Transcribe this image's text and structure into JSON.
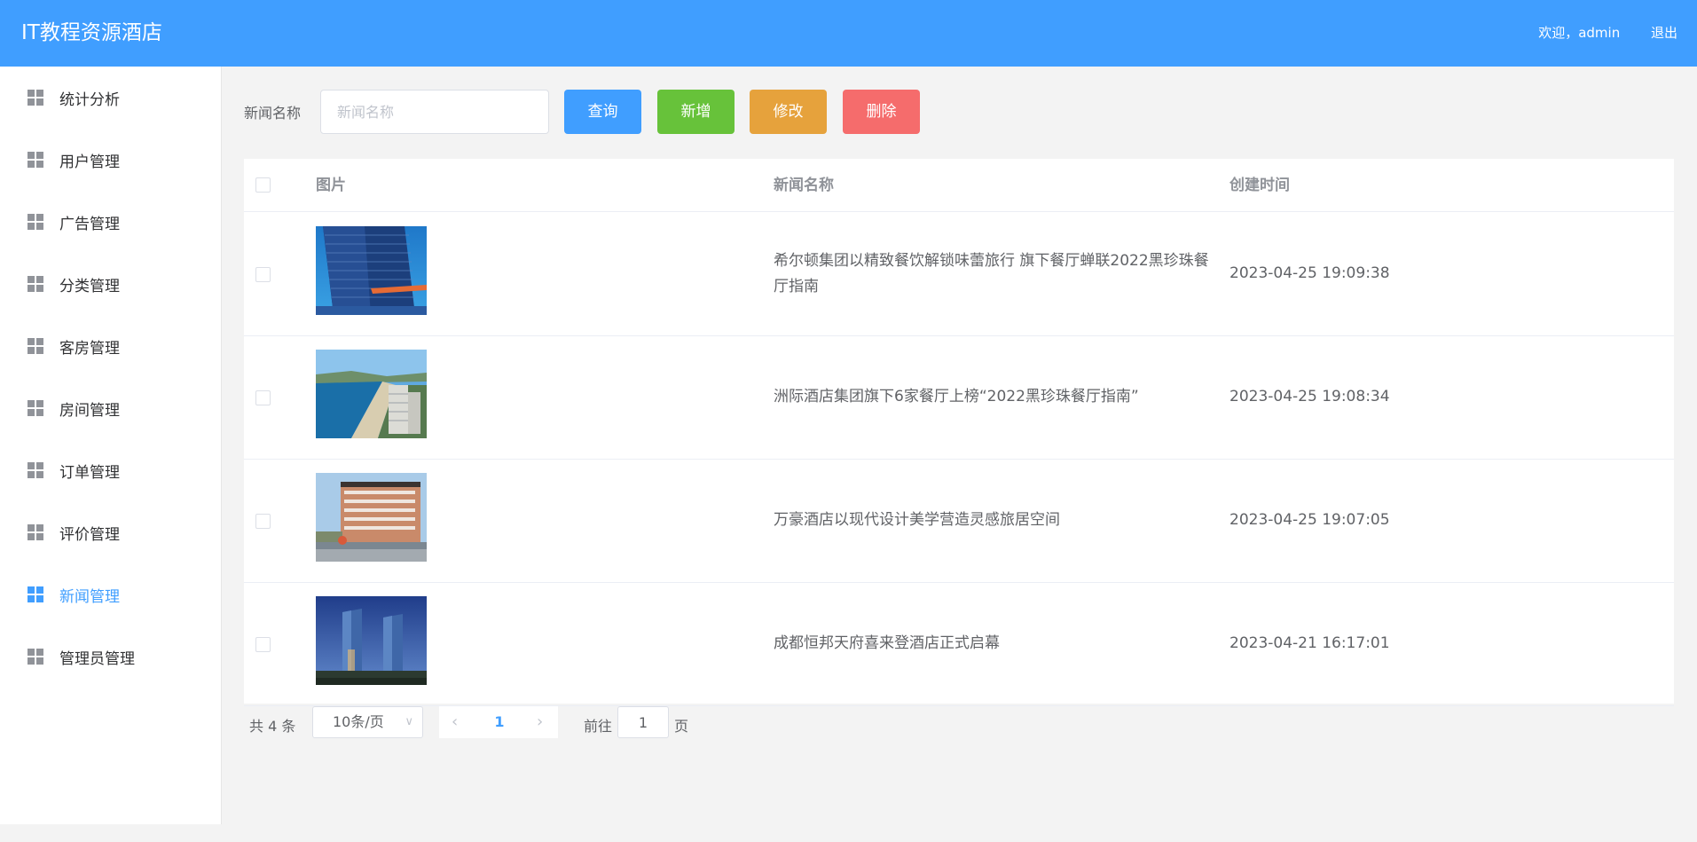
{
  "header": {
    "brand": "IT教程资源酒店",
    "welcome": "欢迎，admin",
    "logout": "退出"
  },
  "sidebar": {
    "items": [
      {
        "label": "统计分析",
        "active": false
      },
      {
        "label": "用户管理",
        "active": false
      },
      {
        "label": "广告管理",
        "active": false
      },
      {
        "label": "分类管理",
        "active": false
      },
      {
        "label": "客房管理",
        "active": false
      },
      {
        "label": "房间管理",
        "active": false
      },
      {
        "label": "订单管理",
        "active": false
      },
      {
        "label": "评价管理",
        "active": false
      },
      {
        "label": "新闻管理",
        "active": true
      },
      {
        "label": "管理员管理",
        "active": false
      }
    ]
  },
  "toolbar": {
    "label": "新闻名称",
    "search_placeholder": "新闻名称",
    "search_value": "",
    "query": "查询",
    "add": "新增",
    "edit": "修改",
    "delete": "删除"
  },
  "table": {
    "columns": [
      "图片",
      "新闻名称",
      "创建时间"
    ],
    "rows": [
      {
        "image": "hotel-tower-photo",
        "title": "希尔顿集团以精致餐饮解锁味蕾旅行 旗下餐厅蝉联2022黑珍珠餐厅指南",
        "created": "2023-04-25 19:09:38"
      },
      {
        "image": "seaside-hotel-photo",
        "title": "洲际酒店集团旗下6家餐厅上榜“2022黑珍珠餐厅指南”",
        "created": "2023-04-25 19:08:34"
      },
      {
        "image": "modern-hotel-facade-photo",
        "title": "万豪酒店以现代设计美学营造灵感旅居空间",
        "created": "2023-04-25 19:07:05"
      },
      {
        "image": "twin-towers-photo",
        "title": "成都恒邦天府喜来登酒店正式启幕",
        "created": "2023-04-21 16:17:01"
      }
    ]
  },
  "pagination": {
    "total": "共 4 条",
    "page_size": "10条/页",
    "current": "1",
    "goto_label": "前往",
    "goto_value": "1",
    "goto_suffix": "页"
  },
  "colors": {
    "primary": "#409eff",
    "success": "#67c23a",
    "warning": "#e6a23c",
    "danger": "#f56c6c"
  }
}
